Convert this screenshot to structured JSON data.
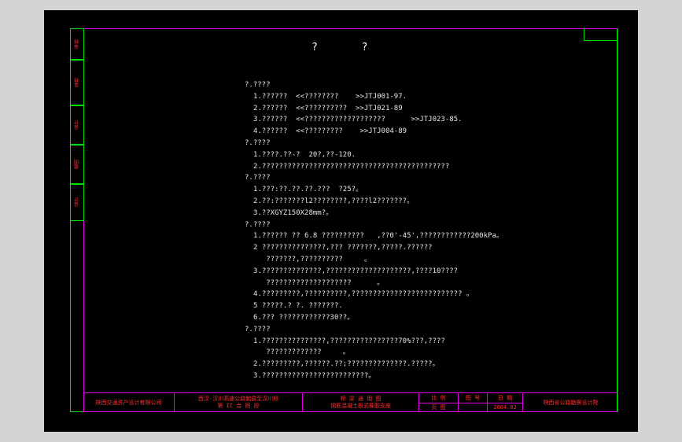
{
  "drawing": {
    "title": "?   ?",
    "left_strip": [
      "审核",
      "复核",
      "设计",
      "描图",
      "设计"
    ],
    "sections": [
      {
        "heading": "?.????",
        "lines": [
          "1.??????  <<????????    >>JTJ001-97.",
          "2.??????  <<??????????  >>JTJ021-89",
          "3.??????  <<???????????????????      >>JTJ023-85.",
          "4.??????  <<?????????    >>JTJ004-89"
        ]
      },
      {
        "heading": "?.????",
        "lines": [
          "1.????.??-?  20?,??-120.",
          "2.????????????????????????????????????????????"
        ]
      },
      {
        "heading": "?.????",
        "lines": [
          "1.???:??.??.??.???  ?25?。",
          "2.??:???????l2????????,????l2???????。",
          "3.??XGYZ150X28mm?。"
        ]
      },
      {
        "heading": "?.????",
        "lines": [
          "1.?????? ?? 6.8 ??????????   ,??0'-45',????????????200kPa。",
          "2 ???????????????,??? ???????,?????.??????",
          "   ???????,??????????     。",
          "3.??????????????,????????????????????,????10????",
          "   ????????????????????      。",
          "4.?????????,??????????,?????????????????????????? 。",
          "5 ?????.? ?. ???????.",
          "6.??? ????????????30??。"
        ]
      },
      {
        "heading": "?.????",
        "lines": [
          "1.???????????????,????????????????70%???,????",
          "   ?????????????     。",
          "2.?????????,??????.??;??????????????.?????。",
          "3.?????????????????????????。"
        ]
      }
    ],
    "title_block": {
      "company": "陕西交通资产设计有限公司",
      "project_line1": "西汉-汉川高速公路勉县至汉川段",
      "project_line2": "第 II 合 同 段",
      "drawing_line1": "桥 梁 通 用 图",
      "drawing_line2": "钢筋混凝土板式橡胶支座",
      "h1": "比 例",
      "h2": "图 号",
      "h3": "日 期",
      "h4": "页 图",
      "date": "2004.02",
      "institute": "陕西省公路勘察设计院"
    }
  }
}
